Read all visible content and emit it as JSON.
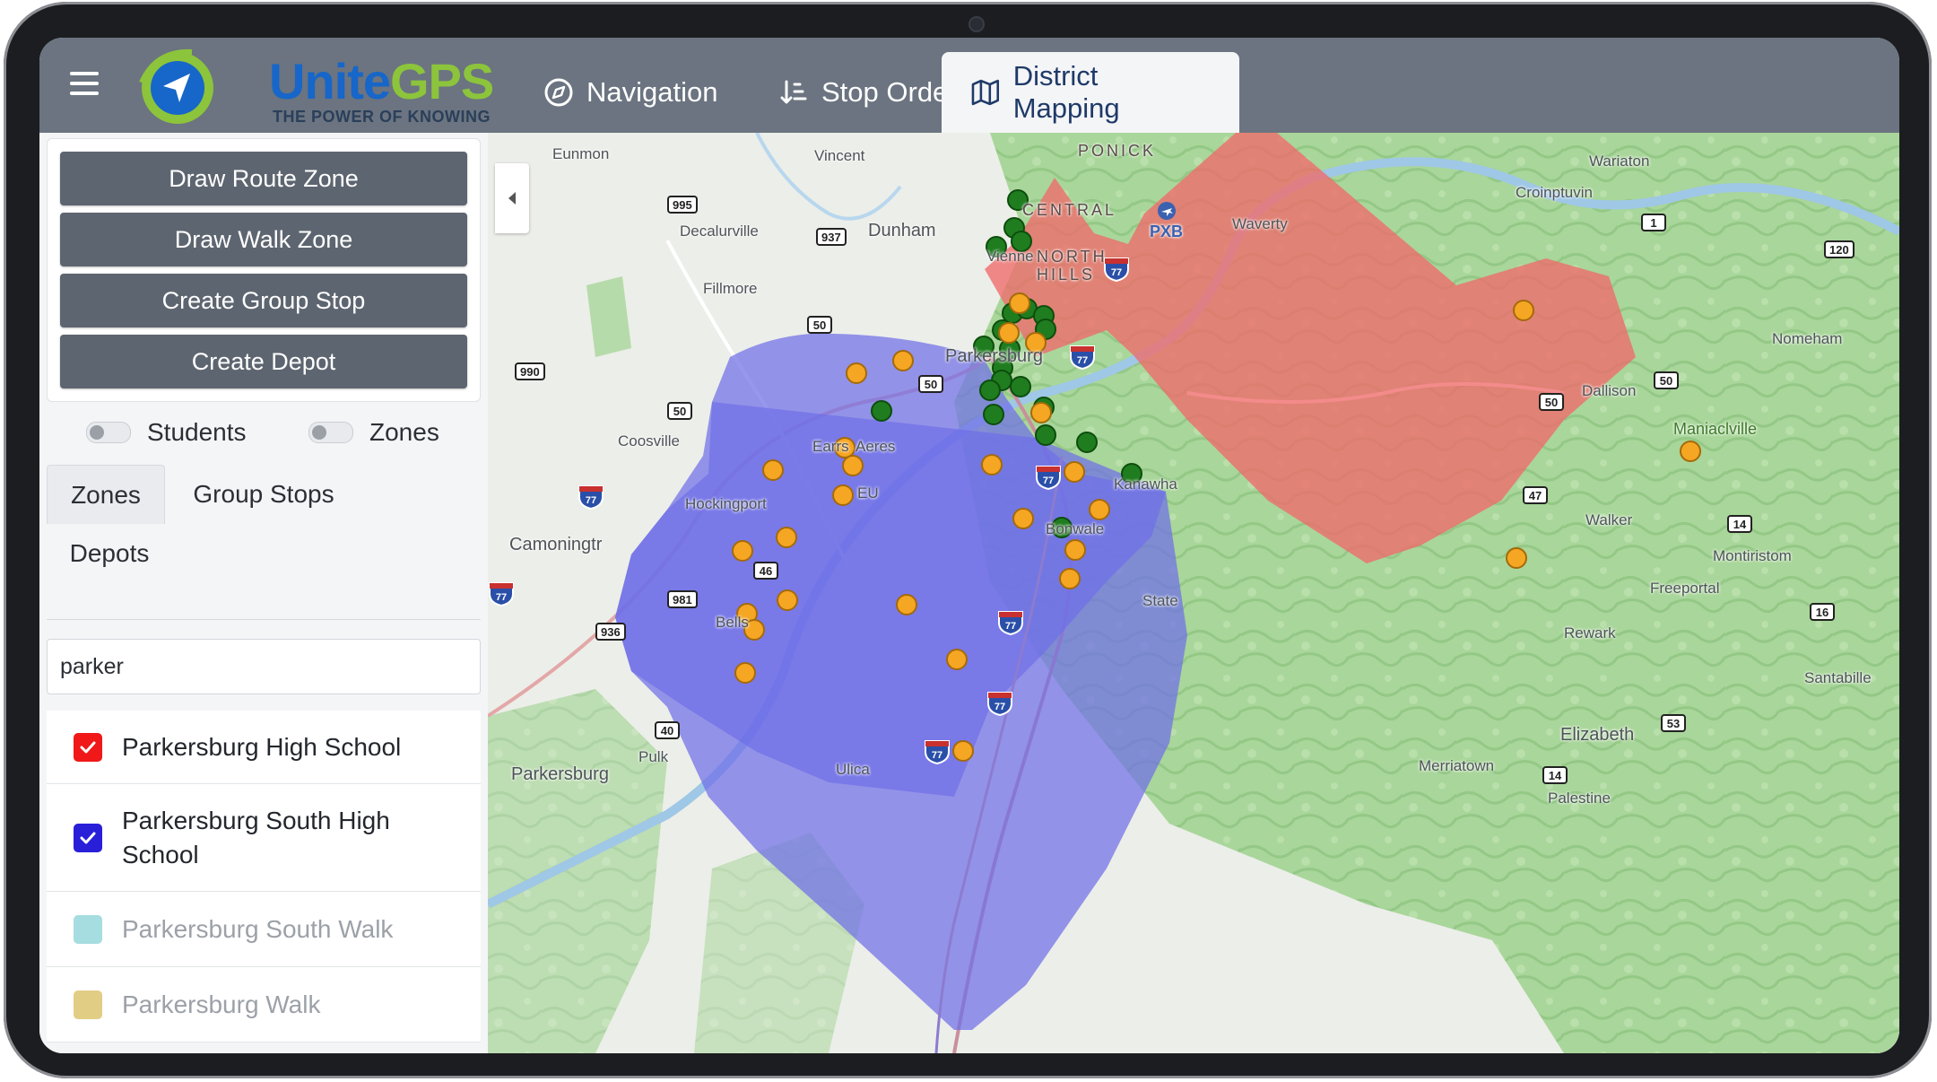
{
  "app": {
    "brand_name_a": "Unite",
    "brand_name_b": "GPS",
    "brand_tagline": "THE POWER OF KNOWING"
  },
  "tabs": [
    {
      "label": "Navigation",
      "icon": "compass-icon",
      "active": false
    },
    {
      "label": "Stop Order",
      "icon": "sort-order-icon",
      "active": false
    },
    {
      "label": "District Mapping",
      "icon": "map-icon",
      "active": true
    }
  ],
  "sidebar": {
    "actions": [
      "Draw Route Zone",
      "Draw Walk Zone",
      "Create Group Stop",
      "Create Depot"
    ],
    "toggles": [
      {
        "label": "Students",
        "on": false
      },
      {
        "label": "Zones",
        "on": false
      }
    ],
    "subtabs": [
      {
        "label": "Zones",
        "active": true
      },
      {
        "label": "Group Stops",
        "active": false
      },
      {
        "label": "Depots",
        "active": false
      }
    ],
    "search": {
      "value": "parker"
    },
    "zones": [
      {
        "label": "Parkersburg High School",
        "checked": true,
        "color": "#f01818"
      },
      {
        "label": "Parkersburg South High School",
        "checked": true,
        "color": "#2a1fd8"
      },
      {
        "label": "Parkersburg South Walk",
        "checked": false,
        "color": "#a6dde0"
      },
      {
        "label": "Parkersburg Walk",
        "checked": false,
        "color": "#e2cd85"
      }
    ]
  },
  "map": {
    "colors": {
      "red_zone": "#f06a6a",
      "blue_zone": "#6f6fe8",
      "stop_orange": "#f5a623",
      "stop_green": "#1f7d1f"
    },
    "places": {
      "eunmon": "Eunmon",
      "vincent": "Vincent",
      "ponick": "PONICK",
      "wariaton": "Wariaton",
      "croinptuvin": "Croinptuvin",
      "central": "CENTRAL",
      "pxb": "PXB",
      "waverty": "Waverty",
      "decalurville": "Decalurville",
      "dunham": "Dunham",
      "vienne": "Vienne",
      "north_hills": "NORTH HILLS",
      "fillmore": "Fillmore",
      "nomeham": "Nomeham",
      "parkersburg_center": "Parkersburg",
      "dallison": "Dallison",
      "coosville": "Coosville",
      "maniaclville": "Maniaclville",
      "earrs": "Earrs",
      "aeres": "Aeres",
      "eu": "EU",
      "kanawha": "Kanawha",
      "hockingport": "Hockingport",
      "walker": "Walker",
      "camoningtr": "Camoningtr",
      "bonwale": "Bonwale",
      "montiristom": "Montiristom",
      "freeportal": "Freeportal",
      "state": "State",
      "bells": "Bells",
      "rewark": "Rewark",
      "santabille": "Santabille",
      "elizabeth": "Elizabeth",
      "pulk": "Pulk",
      "merriatown": "Merriatown",
      "ulica": "Ulica",
      "parkersburg_sw": "Parkersburg",
      "palestine": "Palestine"
    },
    "routes": {
      "r995": "995",
      "r937": "937",
      "r990": "990",
      "r50a": "50",
      "r50b": "50",
      "r50c": "50",
      "r50d": "50",
      "r50e": "50",
      "r1": "1",
      "r120": "120",
      "r46": "46",
      "r981": "981",
      "r936": "936",
      "r47": "47",
      "r14a": "14",
      "r16": "16",
      "r40": "40",
      "r53": "53",
      "r14b": "14",
      "i77": "77"
    }
  }
}
